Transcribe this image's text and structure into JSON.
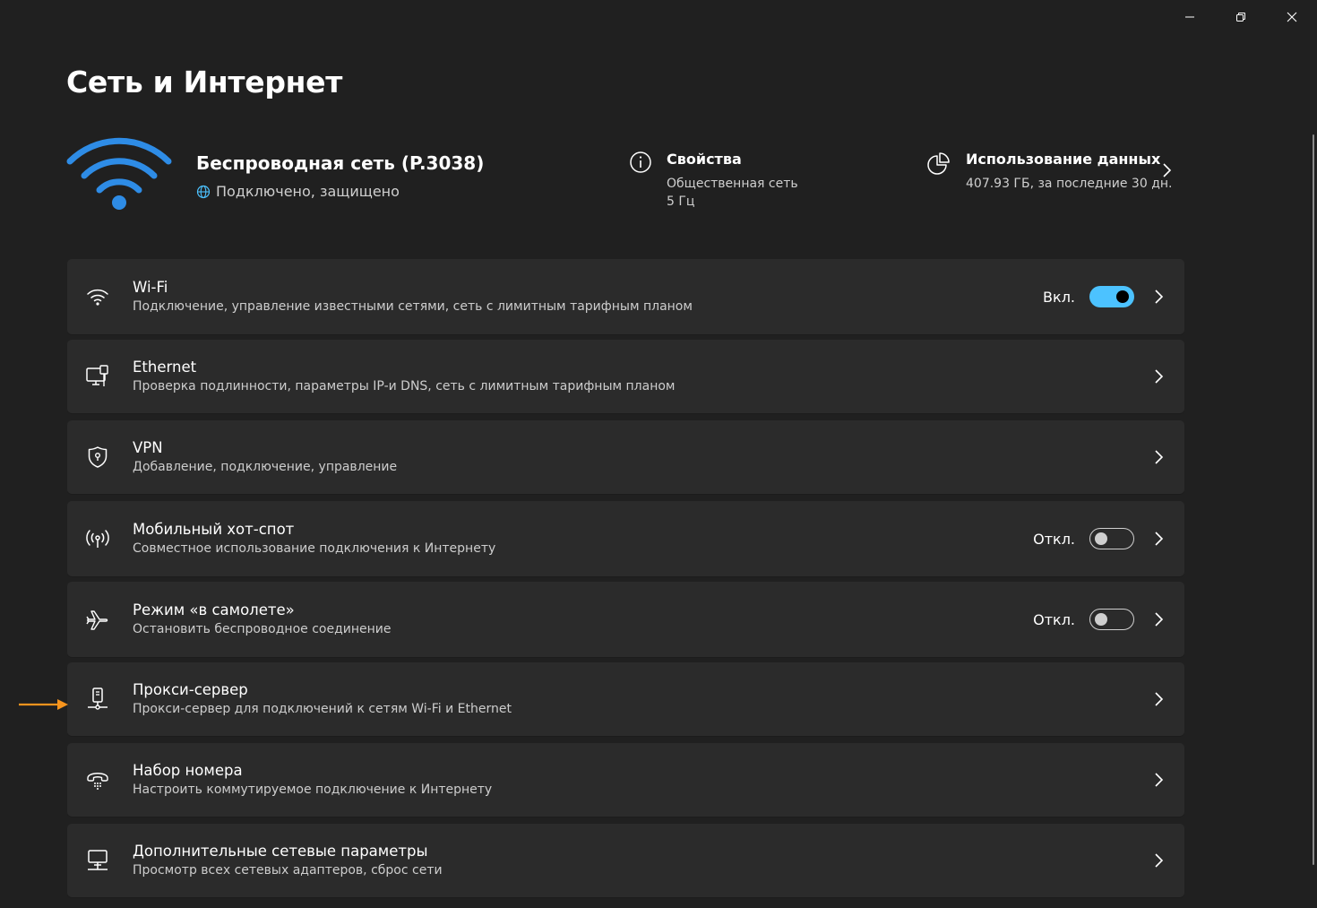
{
  "window": {
    "controls": [
      "minimize",
      "restore",
      "close"
    ]
  },
  "page": {
    "title": "Сеть и Интернет"
  },
  "connection": {
    "name": "Беспроводная сеть (P.3038)",
    "status": "Подключено, защищено",
    "properties": {
      "title": "Свойства",
      "lines": [
        "Общественная сеть",
        "5 Гц"
      ]
    },
    "usage": {
      "title": "Использование данных",
      "detail": "407.93 ГБ, за последние 30 дн."
    }
  },
  "colors": {
    "accent": "#4cc2ff",
    "background": "#202020",
    "card": "#2b2b2b",
    "annotation_arrow": "#f7941d"
  },
  "items": [
    {
      "icon": "wifi-icon",
      "title": "Wi-Fi",
      "subtitle": "Подключение, управление известными сетями, сеть с лимитным тарифным планом",
      "toggle_label": "Вкл.",
      "toggle_on": true
    },
    {
      "icon": "ethernet-icon",
      "title": "Ethernet",
      "subtitle": "Проверка подлинности, параметры IP-и DNS, сеть с лимитным тарифным планом"
    },
    {
      "icon": "vpn-shield-icon",
      "title": "VPN",
      "subtitle": "Добавление, подключение, управление"
    },
    {
      "icon": "hotspot-icon",
      "title": "Мобильный хот-спот",
      "subtitle": "Совместное использование подключения к Интернету",
      "toggle_label": "Откл.",
      "toggle_on": false
    },
    {
      "icon": "airplane-icon",
      "title": "Режим «в самолете»",
      "subtitle": "Остановить беспроводное соединение",
      "toggle_label": "Откл.",
      "toggle_on": false
    },
    {
      "icon": "proxy-icon",
      "title": "Прокси-сервер",
      "subtitle": "Прокси-сервер для подключений к сетям Wi-Fi и Ethernet"
    },
    {
      "icon": "dialup-icon",
      "title": "Набор номера",
      "subtitle": "Настроить коммутируемое подключение к Интернету"
    },
    {
      "icon": "advanced-network-icon",
      "title": "Дополнительные сетевые параметры",
      "subtitle": "Просмотр всех сетевых адаптеров, сброс сети"
    }
  ]
}
